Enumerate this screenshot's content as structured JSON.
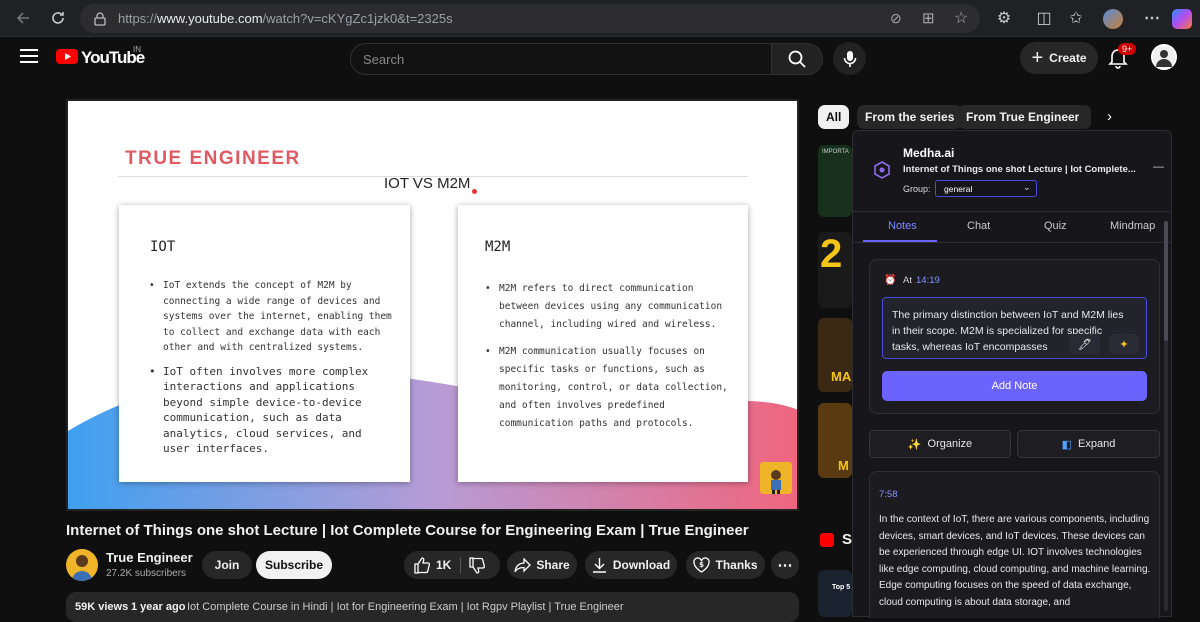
{
  "browser": {
    "url_prefix": "https://",
    "url_host": "www.youtube.com",
    "url_path": "/watch?v=cKYgZc1jzk0&t=2325s"
  },
  "youtube": {
    "logo_text": "YouTube",
    "country_code": "IN",
    "search_placeholder": "Search",
    "create_label": "Create",
    "notification_count": "9+"
  },
  "slide": {
    "brand": "TRUE ENGINEER",
    "title": "IOT VS M2M",
    "left_heading": "IOT",
    "left_points": [
      "IoT extends the concept of M2M by connecting a wide range of devices and systems over the internet, enabling them to collect and exchange data with each other and with centralized systems.",
      "IoT often involves more complex interactions and applications beyond simple device-to-device communication, such as data analytics, cloud services, and user interfaces."
    ],
    "right_heading": "M2M",
    "right_points": [
      "M2M refers to direct communication between devices using any communication channel, including wired and wireless.",
      "M2M communication usually focuses on specific tasks or functions, such as monitoring, control, or data collection, and often involves predefined communication paths and protocols."
    ]
  },
  "video": {
    "title": "Internet of Things one shot Lecture | Iot Complete Course for Engineering Exam | True Engineer",
    "channel": "True Engineer",
    "subscribers": "27.2K subscribers",
    "join": "Join",
    "subscribe": "Subscribe",
    "likes": "1K",
    "share": "Share",
    "download": "Download",
    "thanks": "Thanks",
    "views": "59K views",
    "age": "1 year ago",
    "tags": "Iot Complete Course in Hindi | Iot for Engineering Exam | Iot Rgpv Playlist | True Engineer"
  },
  "chips": {
    "all": "All",
    "series": "From the series",
    "channel": "From True Engineer"
  },
  "medha": {
    "name": "Medha.ai",
    "video_title": "Internet of Things one shot Lecture | Iot Complete...",
    "group_label": "Group:",
    "group_value": "general",
    "tabs": [
      "Notes",
      "Chat",
      "Quiz",
      "Mindmap"
    ],
    "note_at_label": "At",
    "note_time": "14:19",
    "note_text": "The primary distinction between IoT and M2M lies in their scope. M2M is specialized for specific tasks, whereas IoT encompasses",
    "add_note": "Add Note",
    "organize": "Organize",
    "expand": "Expand",
    "entry_time": "7:58",
    "entry_text": "In the context of IoT, there are various components, including devices, smart devices, and IoT devices. These devices can be experienced through edge UI. IOT involves technologies like edge computing, cloud computing, and machine learning. Edge computing focuses on the speed of data exchange, cloud computing is about data storage, and"
  },
  "sidebar": {
    "thumb1_text": "IMPORTA",
    "thumb2_text": "2",
    "thumb3_text": "MA",
    "thumb4_text": "M",
    "shorts_letter": "S",
    "thumb5_text": "Top 5"
  },
  "colors": {
    "brand_red": "#e05a64",
    "youtube_red": "#ff0000",
    "medha_accent": "#6c63ff",
    "subscribe_bg": "#f1f1f1"
  }
}
